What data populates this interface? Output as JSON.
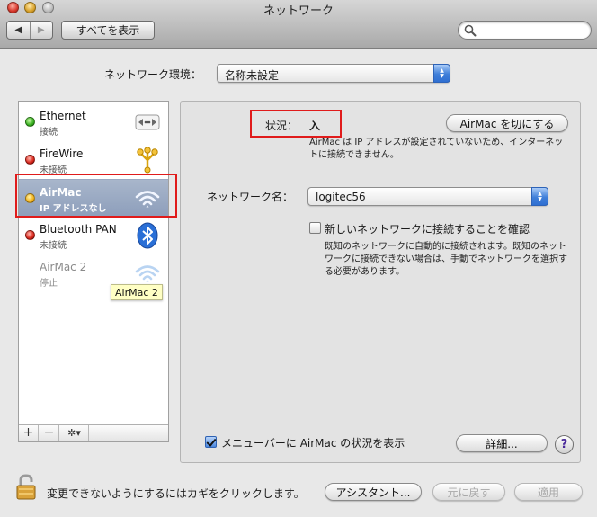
{
  "window": {
    "title": "ネットワーク"
  },
  "toolbar": {
    "back_label": "◀",
    "forward_label": "▶",
    "show_all_label": "すべてを表示",
    "search_value": ""
  },
  "location": {
    "label": "ネットワーク環境：",
    "selected": "名称未設定"
  },
  "services": [
    {
      "name": "Ethernet",
      "status": "接続",
      "status_color": "green",
      "icon": "ethernet-arrows-icon"
    },
    {
      "name": "FireWire",
      "status": "未接続",
      "status_color": "red",
      "icon": "firewire-icon"
    },
    {
      "name": "AirMac",
      "status": "IP アドレスなし",
      "status_color": "yellow",
      "icon": "wifi-icon",
      "selected": true
    },
    {
      "name": "Bluetooth PAN",
      "status": "未接続",
      "status_color": "red",
      "icon": "bluetooth-icon"
    },
    {
      "name": "AirMac 2",
      "status": "停止",
      "status_color": "none",
      "icon": "wifi-icon"
    }
  ],
  "sidebar_controls": {
    "add": "+",
    "remove": "−",
    "action": "✲▾"
  },
  "tooltip": "AirMac 2",
  "detail": {
    "status_label": "状況：",
    "status_value": "入",
    "toggle_button": "AirMac を切にする",
    "status_description": "AirMac は IP アドレスが設定されていないため、インターネットに接続できません。",
    "network_name_label": "ネットワーク名：",
    "network_name_value": "logitec56",
    "confirm_join_label": "新しいネットワークに接続することを確認",
    "confirm_join_checked": false,
    "confirm_join_description": "既知のネットワークに自動的に接続されます。既知のネットワークに接続できない場合は、手動でネットワークを選択する必要があります。",
    "menubar_label": "メニューバーに AirMac の状況を表示",
    "menubar_checked": true,
    "advanced_button": "詳細...",
    "help_label": "?"
  },
  "footer": {
    "lock_text": "変更できないようにするにはカギをクリックします。",
    "assistant_button": "アシスタント...",
    "revert_button": "元に戻す",
    "apply_button": "適用"
  },
  "colors": {
    "highlight_box": "#e01b1b",
    "selection": "#8d9ebb",
    "accent_blue": "#3f7fd9"
  }
}
